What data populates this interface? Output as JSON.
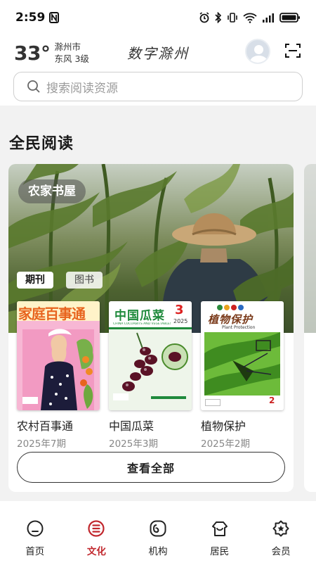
{
  "status_bar": {
    "time": "2:59"
  },
  "header": {
    "temperature": "33°",
    "city": "滁州市",
    "wind": "东风  3级",
    "app_title": "数字滁州",
    "search_placeholder": "搜索阅读资源"
  },
  "section": {
    "title": "全民阅读",
    "card": {
      "tag": "农家书屋",
      "tabs": [
        {
          "label": "期刊",
          "active": true
        },
        {
          "label": "图书",
          "active": false
        }
      ],
      "books": [
        {
          "name": "农村百事通",
          "issue": "2025年7期",
          "cover_title": "家庭百事通"
        },
        {
          "name": "中国瓜菜",
          "issue": "2025年3期",
          "cover_title": "中国瓜菜",
          "cover_number": "3",
          "cover_year": "2025",
          "cover_subtitle": "CHINA CUCURBITS AND VEGETABLES"
        },
        {
          "name": "植物保护",
          "issue": "2025年2期",
          "cover_title": "植物保护",
          "cover_subtitle": "Plant Protection",
          "cover_number": "2"
        }
      ],
      "view_all_label": "查看全部"
    }
  },
  "bottom_nav": [
    {
      "label": "首页",
      "icon": "home-icon",
      "active": false
    },
    {
      "label": "文化",
      "icon": "culture-icon",
      "active": true
    },
    {
      "label": "机构",
      "icon": "institution-icon",
      "active": false
    },
    {
      "label": "居民",
      "icon": "resident-icon",
      "active": false
    },
    {
      "label": "会员",
      "icon": "member-icon",
      "active": false
    }
  ],
  "colors": {
    "accent": "#c1272d",
    "text": "#222222",
    "muted": "#888888",
    "background": "#f2f2f2"
  }
}
